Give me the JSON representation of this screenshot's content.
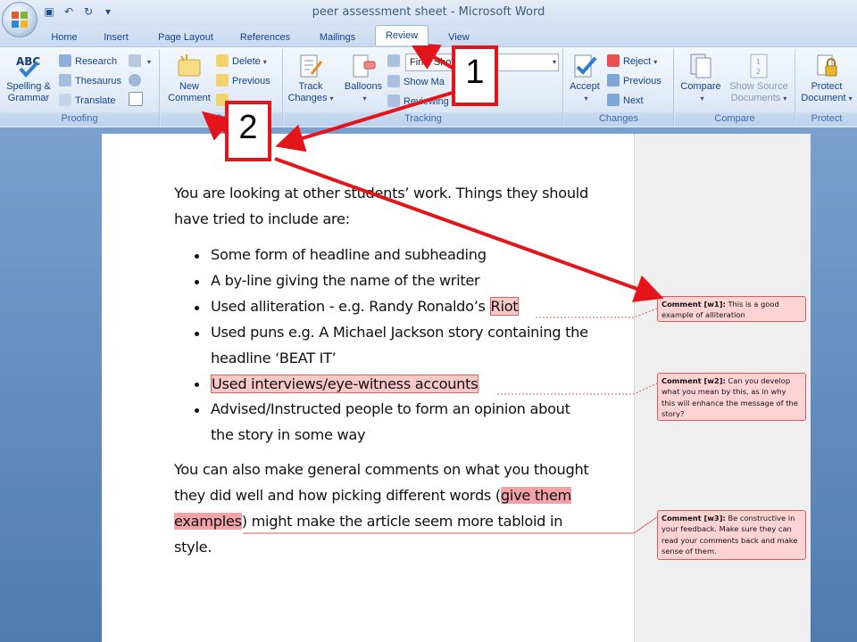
{
  "window": {
    "title": "peer assessment sheet - Microsoft Word"
  },
  "quick_access": {
    "save_icon": "save-icon",
    "undo_icon": "undo-icon",
    "redo_icon": "redo-icon"
  },
  "tabs": [
    "Home",
    "Insert",
    "Page Layout",
    "References",
    "Mailings",
    "Review",
    "View"
  ],
  "active_tab": "Review",
  "ribbon": {
    "proofing": {
      "label": "Proofing",
      "spelling_line1": "Spelling &",
      "spelling_line2": "Grammar",
      "research": "Research",
      "thesaurus": "Thesaurus",
      "translate": "Translate"
    },
    "comments": {
      "label": "Co",
      "new_line1": "New",
      "new_line2": "Comment",
      "delete": "Delete",
      "previous": "Previous",
      "next": "Next"
    },
    "tracking": {
      "label": "Tracking",
      "track_line1": "Track",
      "track_line2": "Changes",
      "balloons": "Balloons",
      "final_showing_markup": "Final Sho   arkup",
      "show_markup": "Show Ma",
      "reviewing_pane": "Reviewing"
    },
    "changes": {
      "label": "Changes",
      "accept": "Accept",
      "reject": "Reject",
      "previous": "Previous",
      "next": "Next"
    },
    "compare": {
      "label": "Compare",
      "compare": "Compare",
      "show_source_line1": "Show Source",
      "show_source_line2": "Documents"
    },
    "protect": {
      "label": "Protect",
      "protect_line1": "Protect",
      "protect_line2": "Document"
    }
  },
  "document": {
    "intro_line1": "You are looking at other students’ work. Things they should",
    "intro_line2": "have tried to include are:",
    "bullets": [
      "Some form of headline and subheading",
      "A by-line giving the name of the writer",
      "Used alliteration - e.g. Randy Ronaldo’s ",
      "Riot",
      "Used puns e.g. A Michael Jackson story containing the",
      "headline ‘BEAT IT’",
      "Used interviews/eye-witness accounts",
      "Advised/Instructed people to form an opinion about",
      "the story in some way"
    ],
    "para2_line1": "You can also make general comments on what you thought",
    "para2_line2_a": "they did well and how picking different words (",
    "para2_line2_b": "give them",
    "para2_line3_a": "examples",
    "para2_line3_b": ") might make the article seem more tabloid in",
    "para2_line4": "style."
  },
  "comments": [
    {
      "tag": "Comment [w1]:",
      "text": " This is a good example of alliteration"
    },
    {
      "tag": "Comment [w2]:",
      "text": " Can you develop what you mean by this, as in why this will enhance the message of the story?"
    },
    {
      "tag": "Comment [w3]:",
      "text": " Be constructive in your feedback. Make sure they can read your comments back and make sense of them."
    }
  ],
  "callouts": {
    "one": "1",
    "two": "2"
  },
  "colors": {
    "callout_red": "#e4141b",
    "comment_fill": "#fdd3d3",
    "highlight": "#f9c8c8"
  }
}
